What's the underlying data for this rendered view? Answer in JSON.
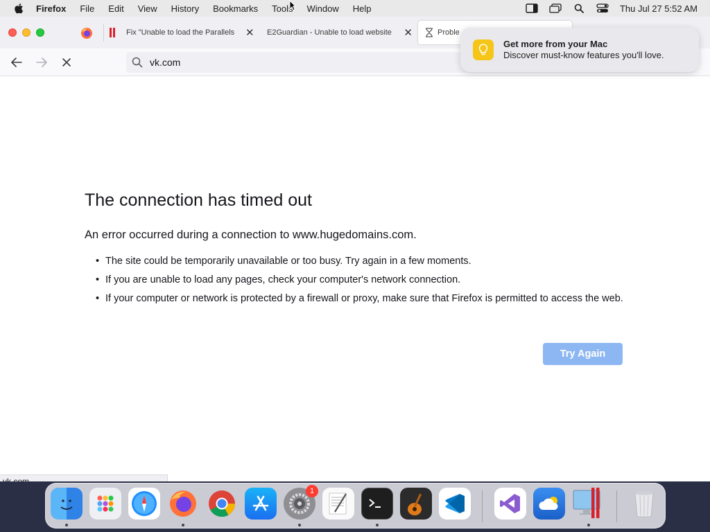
{
  "menubar": {
    "app_name": "Firefox",
    "items": [
      "File",
      "Edit",
      "View",
      "History",
      "Bookmarks",
      "Tools",
      "Window",
      "Help"
    ],
    "clock": "Thu Jul 27  5:52 AM"
  },
  "tabs": [
    {
      "title": "Fix \"Unable to load the Parallels",
      "icon": "parallels-icon"
    },
    {
      "title": "E2Guardian - Unable to load website",
      "icon": "none"
    },
    {
      "title": "Proble",
      "icon": "hourglass-icon"
    }
  ],
  "navbar": {
    "url": "vk.com"
  },
  "notification": {
    "title": "Get more from your Mac",
    "body": "Discover must-know features you'll love."
  },
  "error": {
    "title": "The connection has timed out",
    "description": "An error occurred during a connection to www.hugedomains.com.",
    "bullets": [
      "The site could be temporarily unavailable or too busy. Try again in a few moments.",
      "If you are unable to load any pages, check your computer's network connection.",
      "If your computer or network is protected by a firewall or proxy, make sure that Firefox is permitted to access the web."
    ],
    "button": "Try Again"
  },
  "status_bar": {
    "url": "vk.com"
  },
  "dock": {
    "apps": [
      "Finder",
      "Launchpad",
      "Safari",
      "Firefox",
      "Chrome",
      "App Store",
      "System Settings",
      "TextEdit",
      "Terminal",
      "GarageBand",
      "VS Code",
      "Visual Studio",
      "Cloud App",
      "Parallels Desktop",
      "Trash"
    ],
    "system_settings_badge": "1"
  },
  "colors": {
    "accent": "#8db7f2",
    "notification_bulb": "#f5c518",
    "traffic_red": "#fe5f57",
    "traffic_yellow": "#febc2e",
    "traffic_green": "#28c840"
  }
}
